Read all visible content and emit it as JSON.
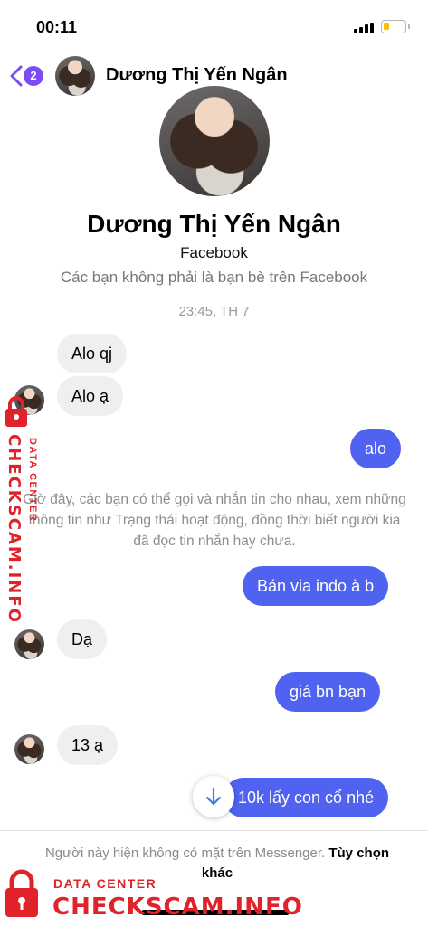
{
  "status_bar": {
    "time": "00:11"
  },
  "header": {
    "back_badge": "2",
    "contact_name": "Dương Thị Yến Ngân"
  },
  "profile": {
    "name": "Dương Thị Yến Ngân",
    "platform": "Facebook",
    "relationship_note": "Các bạn không phải là bạn bè trên Facebook"
  },
  "conversation": {
    "timestamp": "23:45, TH 7",
    "messages": [
      {
        "direction": "incoming",
        "text": "Alo qj"
      },
      {
        "direction": "incoming",
        "text": "Alo ạ"
      },
      {
        "direction": "outgoing",
        "text": "alo"
      },
      {
        "direction": "system",
        "text": "Giờ đây, các bạn có thể gọi và nhắn tin cho nhau, xem những thông tin như Trạng thái hoạt động, đồng thời biết người kia đã đọc tin nhắn hay chưa."
      },
      {
        "direction": "outgoing",
        "text": "Bán via indo à b"
      },
      {
        "direction": "incoming",
        "text": "Dạ"
      },
      {
        "direction": "outgoing",
        "text": "giá bn bạn"
      },
      {
        "direction": "incoming",
        "text": "13 ạ"
      },
      {
        "direction": "outgoing",
        "text": "10k lấy con cổ nhé"
      }
    ]
  },
  "footer": {
    "unavailable_note": "Người này hiện không có mặt trên Messenger.",
    "options_link": "Tùy chọn khác"
  },
  "watermark": {
    "small_text": "DATA CENTER",
    "big_text": "CHECKSCAM.INFO",
    "color": "#e0232a"
  },
  "colors": {
    "outgoing_bubble": "#4f63f0",
    "incoming_bubble": "#efefef",
    "badge": "#7b4cf5"
  },
  "icons": [
    "back-chevron-icon",
    "scroll-down-arrow-icon",
    "signal-icon",
    "battery-icon",
    "lock-icon"
  ]
}
